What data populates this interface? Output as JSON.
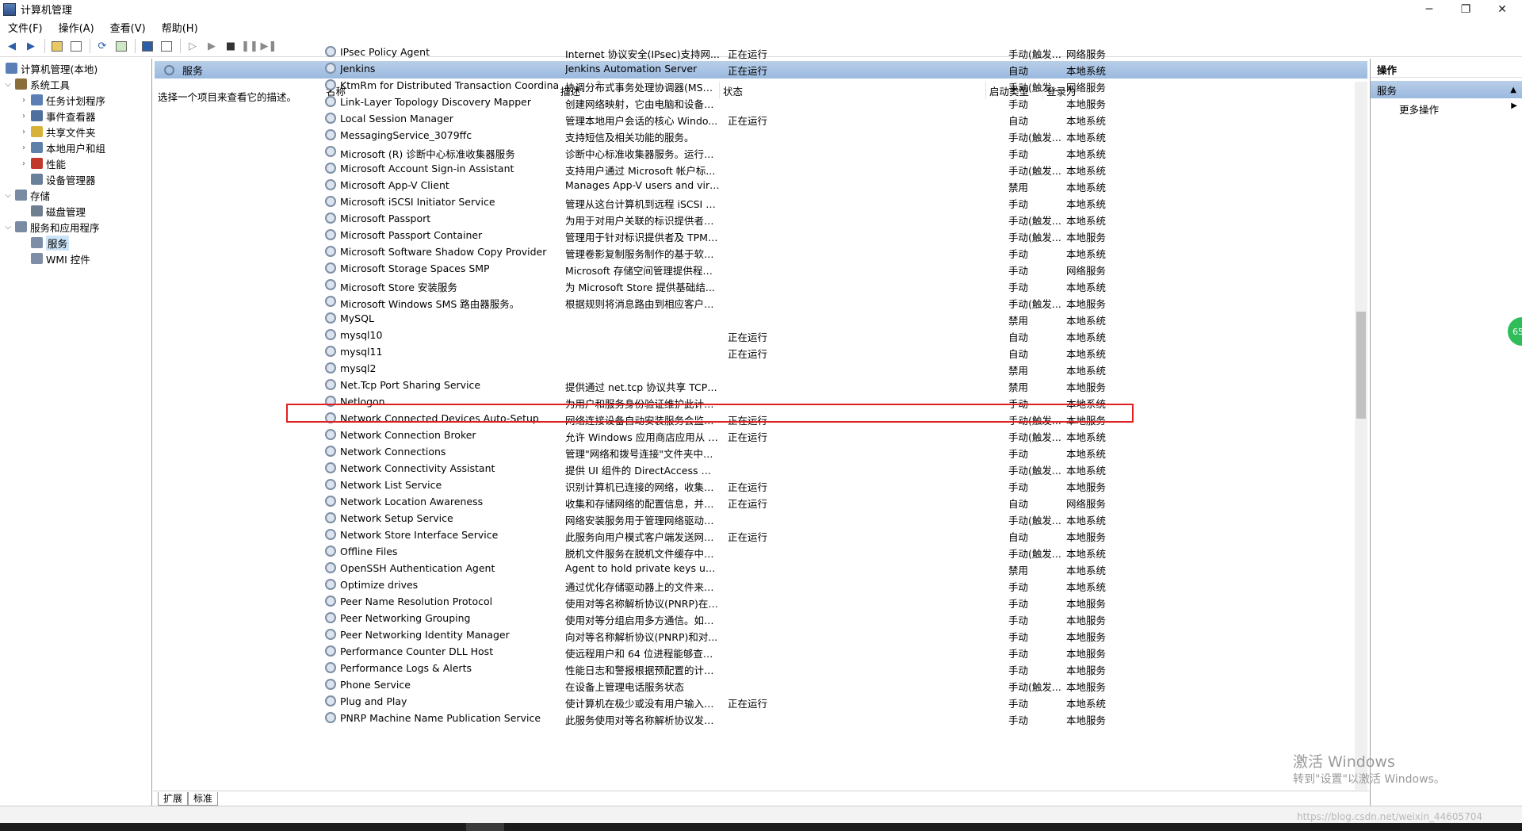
{
  "window": {
    "title": "计算机管理"
  },
  "menu": [
    "文件(F)",
    "操作(A)",
    "查看(V)",
    "帮助(H)"
  ],
  "tree": {
    "root": "计算机管理(本地)",
    "items": [
      {
        "label": "系统工具",
        "level": 1,
        "expanded": true,
        "color": "#8a6d3b"
      },
      {
        "label": "任务计划程序",
        "level": 2,
        "expanded": false,
        "color": "#5b7fb5"
      },
      {
        "label": "事件查看器",
        "level": 2,
        "expanded": false,
        "color": "#4f6f9f"
      },
      {
        "label": "共享文件夹",
        "level": 2,
        "expanded": false,
        "color": "#d6b23a"
      },
      {
        "label": "本地用户和组",
        "level": 2,
        "expanded": false,
        "color": "#5e7fa8"
      },
      {
        "label": "性能",
        "level": 2,
        "expanded": false,
        "color": "#c0392b"
      },
      {
        "label": "设备管理器",
        "level": 2,
        "expanded": null,
        "color": "#6a7f99"
      },
      {
        "label": "存储",
        "level": 1,
        "expanded": true,
        "color": "#7a8ca3"
      },
      {
        "label": "磁盘管理",
        "level": 2,
        "expanded": null,
        "color": "#6f7f8f"
      },
      {
        "label": "服务和应用程序",
        "level": 1,
        "expanded": true,
        "color": "#7a8ca3"
      },
      {
        "label": "服务",
        "level": 2,
        "expanded": null,
        "selected": true,
        "color": "#7d8ea6"
      },
      {
        "label": "WMI 控件",
        "level": 2,
        "expanded": null,
        "color": "#7d8ea6"
      }
    ]
  },
  "services_panel": {
    "header": "服务",
    "desc_hint": "选择一个项目来查看它的描述。",
    "columns": [
      "名称",
      "描述",
      "状态",
      "启动类型",
      "登录为"
    ],
    "rows": [
      [
        "IPsec Policy Agent",
        "Internet 协议安全(IPsec)支持网...",
        "正在运行",
        "手动(触发...",
        "网络服务"
      ],
      [
        "Jenkins",
        "Jenkins Automation Server",
        "正在运行",
        "自动",
        "本地系统"
      ],
      [
        "KtmRm for Distributed Transaction Coordinat...",
        "协调分布式事务处理协调器(MSD...",
        "",
        "手动(触发...",
        "网络服务"
      ],
      [
        "Link-Layer Topology Discovery Mapper",
        "创建网络映射，它由电脑和设备拓...",
        "",
        "手动",
        "本地服务"
      ],
      [
        "Local Session Manager",
        "管理本地用户会话的核心 Windo...",
        "正在运行",
        "自动",
        "本地系统"
      ],
      [
        "MessagingService_3079ffc",
        "支持短信及相关功能的服务。",
        "",
        "手动(触发...",
        "本地系统"
      ],
      [
        "Microsoft (R) 诊断中心标准收集器服务",
        "诊断中心标准收集器服务。运行时...",
        "",
        "手动",
        "本地系统"
      ],
      [
        "Microsoft Account Sign-in Assistant",
        "支持用户通过 Microsoft 帐户标...",
        "",
        "手动(触发...",
        "本地系统"
      ],
      [
        "Microsoft App-V Client",
        "Manages App-V users and virt...",
        "",
        "禁用",
        "本地系统"
      ],
      [
        "Microsoft iSCSI Initiator Service",
        "管理从这台计算机到远程 iSCSI 目...",
        "",
        "手动",
        "本地系统"
      ],
      [
        "Microsoft Passport",
        "为用于对用户关联的标识提供者进...",
        "",
        "手动(触发...",
        "本地系统"
      ],
      [
        "Microsoft Passport Container",
        "管理用于针对标识提供者及 TPM ...",
        "",
        "手动(触发...",
        "本地服务"
      ],
      [
        "Microsoft Software Shadow Copy Provider",
        "管理卷影复制服务制作的基于软件...",
        "",
        "手动",
        "本地系统"
      ],
      [
        "Microsoft Storage Spaces SMP",
        "Microsoft 存储空间管理提供程序...",
        "",
        "手动",
        "网络服务"
      ],
      [
        "Microsoft Store 安装服务",
        "为 Microsoft Store 提供基础结...",
        "",
        "手动",
        "本地系统"
      ],
      [
        "Microsoft Windows SMS 路由器服务。",
        "根据规则将消息路由到相应客户端...",
        "",
        "手动(触发...",
        "本地服务"
      ],
      [
        "MySQL",
        "",
        "",
        "禁用",
        "本地系统"
      ],
      [
        "mysql10",
        "",
        "正在运行",
        "自动",
        "本地系统"
      ],
      [
        "mysql11",
        "",
        "正在运行",
        "自动",
        "本地系统"
      ],
      [
        "mysql2",
        "",
        "",
        "禁用",
        "本地系统"
      ],
      [
        "Net.Tcp Port Sharing Service",
        "提供通过 net.tcp 协议共享 TCP ...",
        "",
        "禁用",
        "本地服务"
      ],
      [
        "Netlogon",
        "为用户和服务身份验证维护此计算...",
        "",
        "手动",
        "本地系统"
      ],
      [
        "Network Connected Devices Auto-Setup",
        "网络连接设备自动安装服务会监视...",
        "正在运行",
        "手动(触发...",
        "本地服务"
      ],
      [
        "Network Connection Broker",
        "允许 Windows 应用商店应用从 I...",
        "正在运行",
        "手动(触发...",
        "本地系统"
      ],
      [
        "Network Connections",
        "管理\"网络和拨号连接\"文件夹中对...",
        "",
        "手动",
        "本地系统"
      ],
      [
        "Network Connectivity Assistant",
        "提供 UI 组件的 DirectAccess 状...",
        "",
        "手动(触发...",
        "本地系统"
      ],
      [
        "Network List Service",
        "识别计算机已连接的网络，收集和...",
        "正在运行",
        "手动",
        "本地服务"
      ],
      [
        "Network Location Awareness",
        "收集和存储网络的配置信息，并在...",
        "正在运行",
        "自动",
        "网络服务"
      ],
      [
        "Network Setup Service",
        "网络安装服务用于管理网络驱动程...",
        "",
        "手动(触发...",
        "本地系统"
      ],
      [
        "Network Store Interface Service",
        "此服务向用户模式客户端发送网络...",
        "正在运行",
        "自动",
        "本地服务"
      ],
      [
        "Offline Files",
        "脱机文件服务在脱机文件缓存中执...",
        "",
        "手动(触发...",
        "本地系统"
      ],
      [
        "OpenSSH Authentication Agent",
        "Agent to hold private keys use...",
        "",
        "禁用",
        "本地系统"
      ],
      [
        "Optimize drives",
        "通过优化存储驱动器上的文件来帮...",
        "",
        "手动",
        "本地系统"
      ],
      [
        "Peer Name Resolution Protocol",
        "使用对等名称解析协议(PNRP)在 I...",
        "",
        "手动",
        "本地服务"
      ],
      [
        "Peer Networking Grouping",
        "使用对等分组启用多方通信。如果...",
        "",
        "手动",
        "本地服务"
      ],
      [
        "Peer Networking Identity Manager",
        "向对等名称解析协议(PNRP)和对...",
        "",
        "手动",
        "本地服务"
      ],
      [
        "Performance Counter DLL Host",
        "使远程用户和 64 位进程能够查询 ...",
        "",
        "手动",
        "本地服务"
      ],
      [
        "Performance Logs & Alerts",
        "性能日志和警报根据预配置的计划...",
        "",
        "手动",
        "本地服务"
      ],
      [
        "Phone Service",
        "在设备上管理电话服务状态",
        "",
        "手动(触发...",
        "本地服务"
      ],
      [
        "Plug and Play",
        "使计算机在极少或没有用户输入的...",
        "正在运行",
        "手动",
        "本地系统"
      ],
      [
        "PNRP Machine Name Publication Service",
        "此服务使用对等名称解析协议发布...",
        "",
        "手动",
        "本地服务"
      ]
    ]
  },
  "bottom_tabs": [
    "扩展",
    "标准"
  ],
  "actions": {
    "title": "操作",
    "section": "服务",
    "more": "更多操作"
  },
  "watermark": {
    "line1": "激活 Windows",
    "line2": "转到\"设置\"以激活 Windows。"
  },
  "url_watermark": "https://blog.csdn.net/weixin_44605704",
  "bubble": "65",
  "colors": {
    "header_blue": "#9ab9df",
    "highlight": "#e02020",
    "selection": "#cce4f7"
  }
}
